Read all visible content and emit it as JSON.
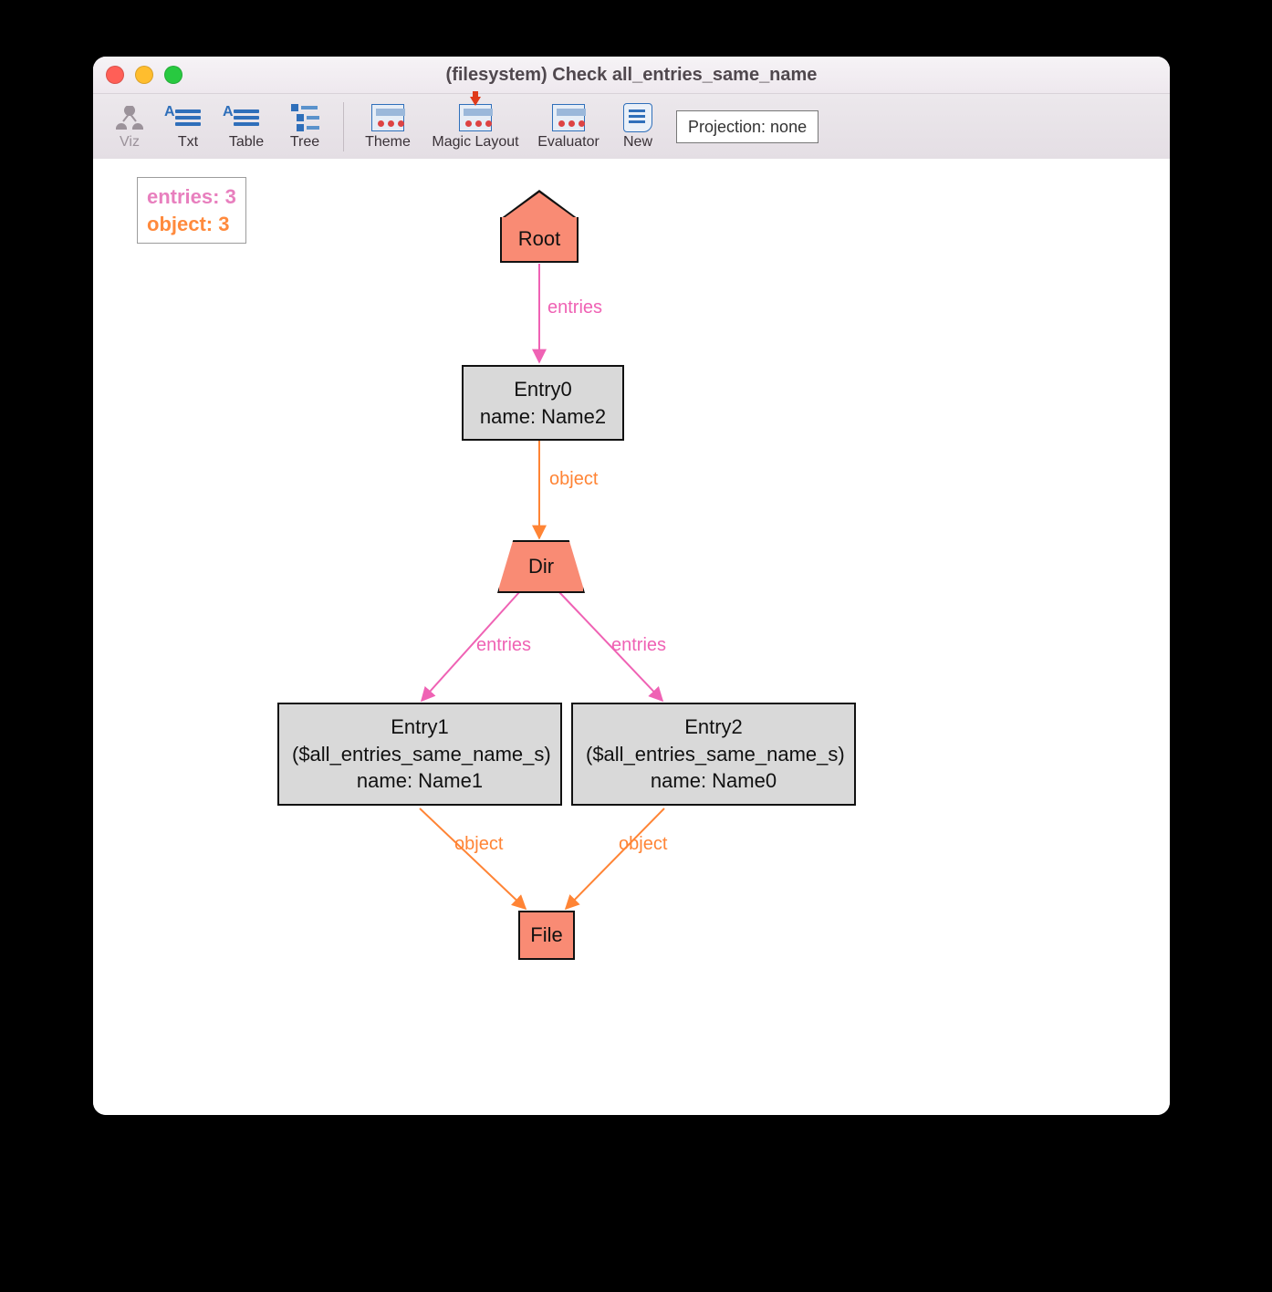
{
  "window": {
    "title": "(filesystem) Check all_entries_same_name"
  },
  "toolbar": {
    "viz": "Viz",
    "txt": "Txt",
    "table": "Table",
    "tree": "Tree",
    "theme": "Theme",
    "magic_layout": "Magic Layout",
    "evaluator": "Evaluator",
    "new": "New",
    "projection": "Projection: none"
  },
  "legend": {
    "entries": "entries: 3",
    "object": "object: 3"
  },
  "nodes": {
    "root": "Root",
    "entry0_l1": "Entry0",
    "entry0_l2": "name: Name2",
    "dir": "Dir",
    "entry1_l1": "Entry1",
    "entry1_l2": "($all_entries_same_name_s)",
    "entry1_l3": "name: Name1",
    "entry2_l1": "Entry2",
    "entry2_l2": "($all_entries_same_name_s)",
    "entry2_l3": "name: Name0",
    "file": "File"
  },
  "edges": {
    "entries": "entries",
    "object": "object"
  },
  "colors": {
    "salmon": "#f98b74",
    "entries_pink": "#ef62b4",
    "object_orange": "#ff8435",
    "grey_box": "#d9d9d9"
  }
}
